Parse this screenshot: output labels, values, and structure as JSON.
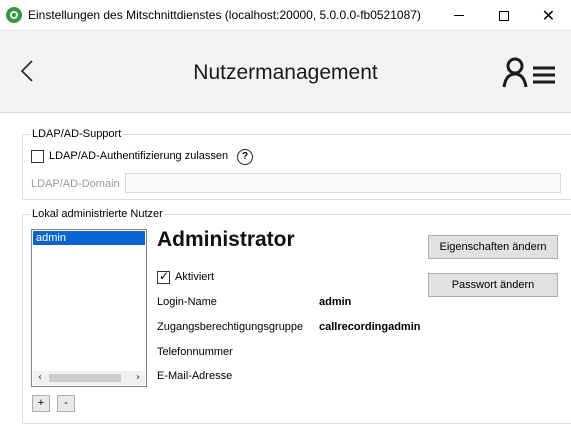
{
  "window": {
    "title": "Einstellungen des Mitschnittdienstes (localhost:20000, 5.0.0.0-fb0521087)",
    "minimize_glyph": "—",
    "maximize_glyph": "☐",
    "close_glyph": "✕"
  },
  "header": {
    "back_glyph": "‹",
    "title": "Nutzermanagement",
    "menu_icon": "user-menu-icon"
  },
  "ldap": {
    "group_label": "LDAP/AD-Support",
    "auth_checkbox_label": "LDAP/AD-Authentifizierung zulassen",
    "auth_checked": false,
    "help_glyph": "?",
    "domain_label": "LDAP/AD-Domain",
    "domain_value": ""
  },
  "users": {
    "group_label": "Lokal administrierte Nutzer",
    "list": [
      "admin"
    ],
    "selected_index": 0,
    "add_label": "+",
    "remove_label": "-",
    "scroll_left": "‹",
    "scroll_right": "›"
  },
  "detail": {
    "heading": "Administrator",
    "activated_label": "Aktiviert",
    "activated_checked": true,
    "login_label": "Login-Name",
    "login_value": "admin",
    "group_label": "Zugangsberechtigungsgruppe",
    "group_value": "callrecordingadmin",
    "phone_label": "Telefonnummer",
    "phone_value": "",
    "email_label": "E-Mail-Adresse",
    "email_value": "",
    "edit_button": "Eigenschaften ändern",
    "password_button": "Passwort ändern"
  },
  "colors": {
    "accent_green": "#2e9a3a",
    "selection_blue": "#0a64d6",
    "header_bg": "#f3f3f3"
  }
}
